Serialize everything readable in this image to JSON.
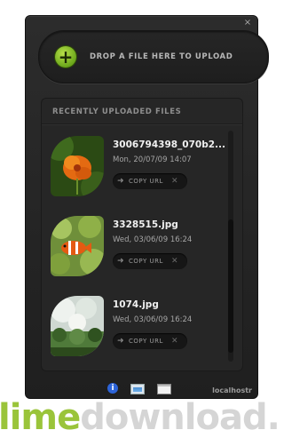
{
  "drop_zone": {
    "label": "DROP A FILE HERE TO UPLOAD",
    "icon": "plus-icon"
  },
  "files_section": {
    "title": "RECENTLY UPLOADED FILES"
  },
  "files": [
    {
      "name": "3006794398_070b2...",
      "date": "Mon, 20/07/09 14:07",
      "copy_label": "COPY URL"
    },
    {
      "name": "3328515.jpg",
      "date": "Wed, 03/06/09 16:24",
      "copy_label": "COPY URL"
    },
    {
      "name": "1074.jpg",
      "date": "Wed, 03/06/09 16:24",
      "copy_label": "COPY URL"
    }
  ],
  "footer": {
    "brand": "localhostr"
  },
  "watermark": {
    "part1": "lime",
    "part2": "download.com"
  },
  "colors": {
    "panel": "#262626",
    "accent_green": "#7bb424",
    "info_blue": "#2d64d8"
  }
}
